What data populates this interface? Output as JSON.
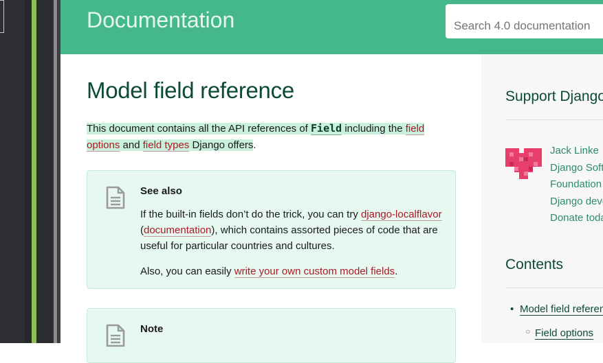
{
  "header": {
    "title": "Documentation",
    "search_placeholder": "Search 4.0 documentation"
  },
  "main": {
    "heading": "Model field reference",
    "intro": {
      "text1": "This document contains all the API references of ",
      "code": "Field",
      "text2": " including the ",
      "link1": "field options",
      "text3": " and ",
      "link2": "field types",
      "text4": " Django offers",
      "text5": "."
    },
    "see_also": {
      "title": "See also",
      "p1_text1": "If the built-in fields don’t do the trick, you can try ",
      "p1_link1": "django-localflavor",
      "p1_text2": " (",
      "p1_link2": "documentation",
      "p1_text3": "), which contains assorted pieces of code that are useful for particular countries and cultures.",
      "p2_text1": "Also, you can easily ",
      "p2_link": "write your own custom model fields",
      "p2_text2": "."
    },
    "note": {
      "title": "Note"
    }
  },
  "sidebar": {
    "support_heading": "Support Django",
    "sponsor_lines": [
      "Jack Linke",
      "Django Soft",
      "Foundation",
      "Django deve",
      "Donate toda"
    ],
    "contents_heading": "Contents",
    "toc": [
      {
        "label": "Model field reference",
        "level": 1
      },
      {
        "label": "Field options",
        "level": 2
      }
    ]
  },
  "colors": {
    "header_bg": "#44b78b",
    "heading_text": "#0c4b33",
    "link": "#ab1a23",
    "admonition_bg": "#e6f8ef",
    "highlight": "#c9f0dd"
  }
}
